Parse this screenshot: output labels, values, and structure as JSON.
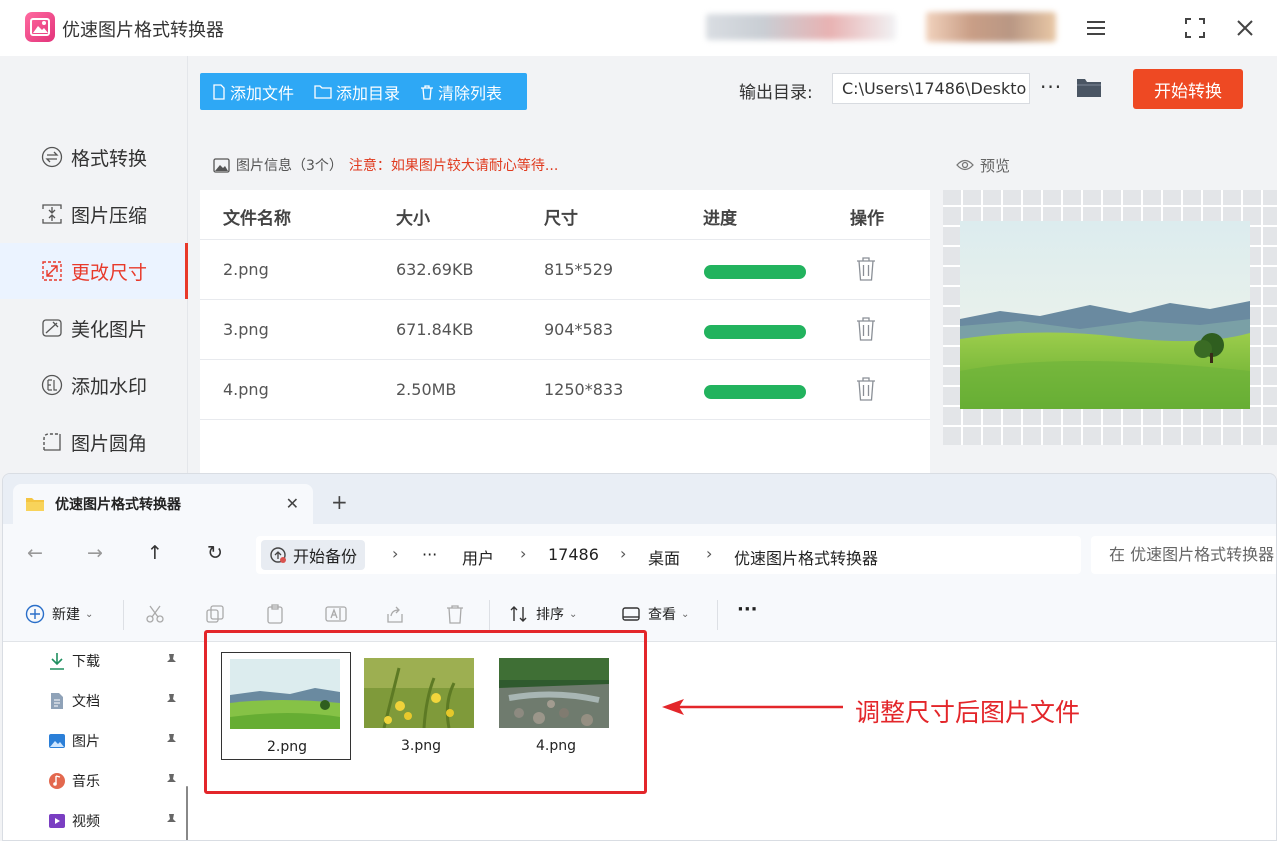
{
  "app": {
    "title": "优速图片格式转换器",
    "colors": {
      "accent_blue": "#2ea8f5",
      "start_red": "#ee4923",
      "progress_green": "#22b35e",
      "active_red": "#e8392a"
    }
  },
  "sidebar": {
    "items": [
      {
        "label": "格式转换",
        "icon": "format-convert-icon"
      },
      {
        "label": "图片压缩",
        "icon": "compress-icon"
      },
      {
        "label": "更改尺寸",
        "icon": "resize-icon",
        "active": true
      },
      {
        "label": "美化图片",
        "icon": "beautify-icon"
      },
      {
        "label": "添加水印",
        "icon": "watermark-icon"
      },
      {
        "label": "图片圆角",
        "icon": "round-corner-icon"
      }
    ]
  },
  "toolbar": {
    "add_file": "添加文件",
    "add_dir": "添加目录",
    "clear_list": "清除列表",
    "output_label": "输出目录:",
    "output_path": "C:\\Users\\17486\\Deskto",
    "more": "···",
    "start": "开始转换"
  },
  "file_info": {
    "title": "图片信息（3个）",
    "note": "注意：如果图片较大请耐心等待...",
    "columns": [
      "文件名称",
      "大小",
      "尺寸",
      "进度",
      "操作"
    ],
    "rows": [
      {
        "name": "2.png",
        "size": "632.69KB",
        "dims": "815*529",
        "progress": 1.0
      },
      {
        "name": "3.png",
        "size": "671.84KB",
        "dims": "904*583",
        "progress": 1.0
      },
      {
        "name": "4.png",
        "size": "2.50MB",
        "dims": "1250*833",
        "progress": 1.0
      }
    ]
  },
  "preview": {
    "title": "预览"
  },
  "explorer": {
    "tab_title": "优速图片格式转换器",
    "new_tab": "+",
    "breadcrumbs": [
      "开始备份",
      "···",
      "用户",
      "17486",
      "桌面",
      "优速图片格式转换器"
    ],
    "search_placeholder": "在 优速图片格式转换器",
    "commands": {
      "new": "新建",
      "sort": "排序",
      "view": "查看",
      "more": "···"
    },
    "quick_access": [
      {
        "label": "下载",
        "icon": "download-icon"
      },
      {
        "label": "文档",
        "icon": "document-icon"
      },
      {
        "label": "图片",
        "icon": "pictures-icon"
      },
      {
        "label": "音乐",
        "icon": "music-icon"
      },
      {
        "label": "视频",
        "icon": "video-icon"
      }
    ],
    "files": [
      {
        "name": "2.png",
        "selected": true
      },
      {
        "name": "3.png",
        "selected": false
      },
      {
        "name": "4.png",
        "selected": false
      }
    ]
  },
  "annotation": {
    "text": "调整尺寸后图片文件"
  }
}
